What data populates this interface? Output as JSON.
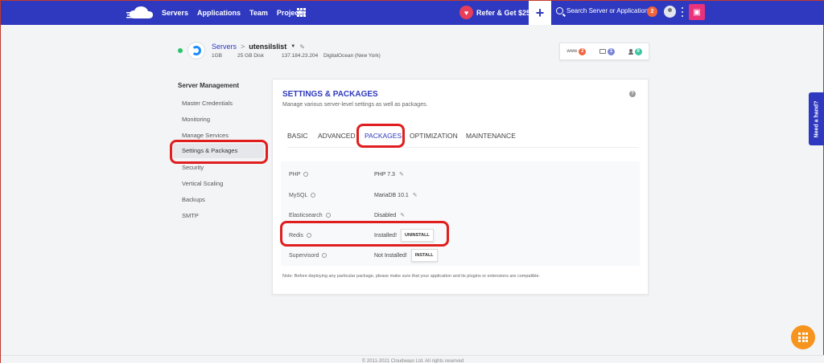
{
  "nav": {
    "links": [
      "Servers",
      "Applications",
      "Team",
      "Projects"
    ],
    "refer_label": "Refer & Get $25",
    "add_label": "+",
    "search_placeholder": "Search Server or Application",
    "notif_count": "2",
    "brand_color": "#2f39bf"
  },
  "server": {
    "breadcrumb_root": "Servers",
    "breadcrumb_sep": ">",
    "name": "utensilslist",
    "ram": "1GB",
    "disk": "25 GB Disk",
    "ip": "137.184.23.204",
    "provider": "DigitalOcean (New York)",
    "stats": [
      {
        "label": "www",
        "count": "2",
        "color": "#f0643e"
      },
      {
        "label": "",
        "count": "1",
        "color": "#7b86d6"
      },
      {
        "label": "",
        "count": "0",
        "color": "#3cc4a4"
      }
    ]
  },
  "sidebar": {
    "title": "Server Management",
    "items": [
      "Master Credentials",
      "Monitoring",
      "Manage Services",
      "Settings & Packages",
      "Security",
      "Vertical Scaling",
      "Backups",
      "SMTP"
    ]
  },
  "card": {
    "title": "SETTINGS & PACKAGES",
    "subtitle": "Manage various server-level settings as well as packages.",
    "help": "?",
    "tabs": [
      "BASIC",
      "ADVANCED",
      "PACKAGES",
      "OPTIMIZATION",
      "MAINTENANCE"
    ],
    "packages": [
      {
        "name": "PHP",
        "value": "PHP 7.3"
      },
      {
        "name": "MySQL",
        "value": "MariaDB 10.1"
      },
      {
        "name": "Elasticsearch",
        "value": "Disabled"
      },
      {
        "name": "Redis",
        "value": "Installed!",
        "button": "UNINSTALL"
      },
      {
        "name": "Supervisord",
        "value": "Not Installed!",
        "button": "INSTALL"
      }
    ],
    "note": "Note: Before deploying any particular package, please make sure that your application and its plugins or extensions are compatible."
  },
  "need_hand": "Need a hand?",
  "footer": "© 2011-2021 Cloudways Ltd. All rights reserved"
}
